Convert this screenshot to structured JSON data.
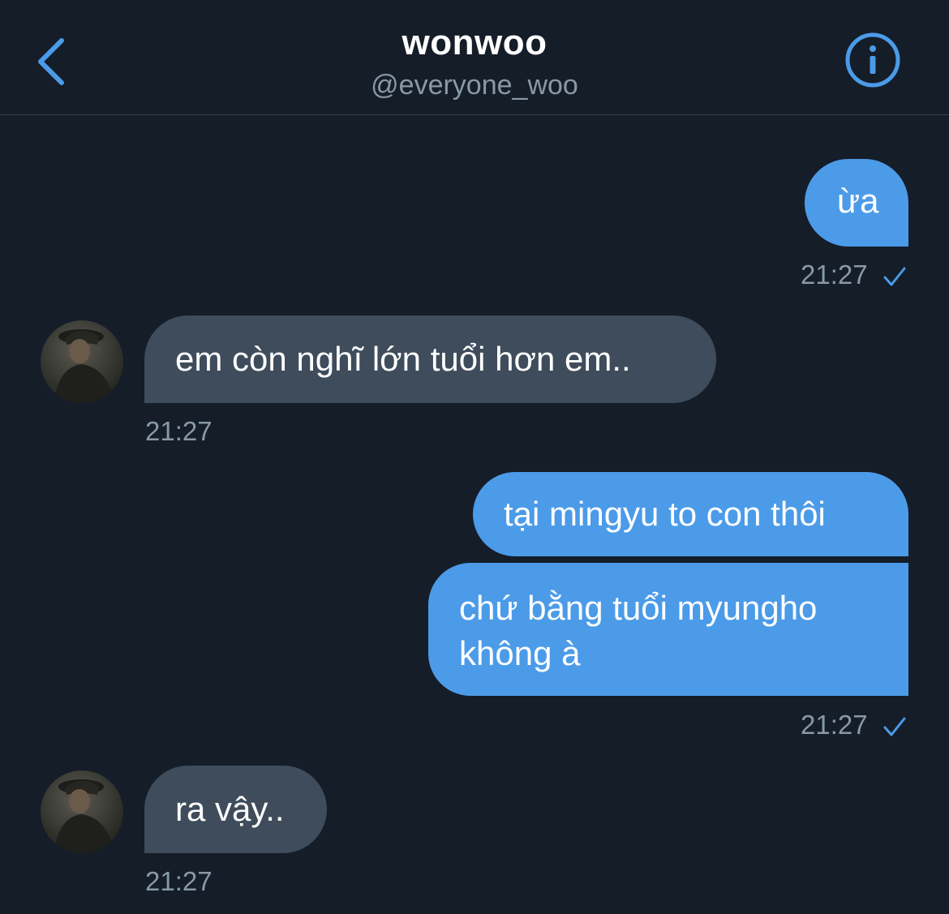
{
  "header": {
    "back_icon": "chevron-left-icon",
    "name": "wonwoo",
    "handle": "@everyone_woo",
    "info_icon": "info-icon",
    "accent_color": "#4b9be8"
  },
  "messages": [
    {
      "direction": "sent",
      "text": "ừa",
      "time": "21:27",
      "read_icon": "checkmark-icon"
    },
    {
      "direction": "received",
      "text": "em còn nghĩ lớn tuổi hơn em..",
      "time": "21:27"
    },
    {
      "direction": "sent",
      "text": "tại mingyu to con thôi"
    },
    {
      "direction": "sent",
      "lines": [
        "chứ bằng tuổi myungho",
        "không à"
      ],
      "time": "21:27",
      "read_icon": "checkmark-icon"
    },
    {
      "direction": "received",
      "text": "ra vậy..",
      "time": "21:27"
    }
  ]
}
